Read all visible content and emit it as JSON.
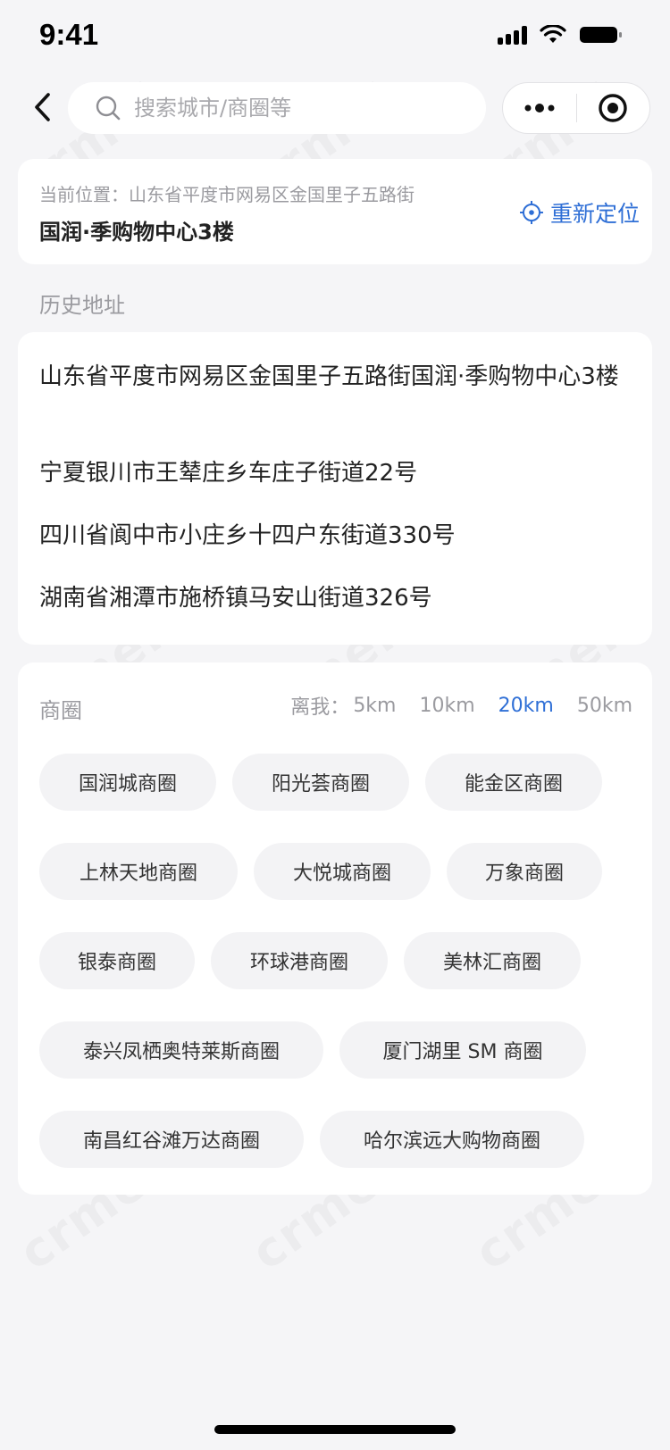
{
  "status_bar": {
    "time": "9:41"
  },
  "nav": {
    "search_placeholder": "搜索城市/商圈等",
    "back_icon": "chevron-left-icon",
    "more_icon": "more-dots-icon",
    "close_icon": "target-circle-icon"
  },
  "current_location": {
    "label": "当前位置：山东省平度市网易区金国里子五路街",
    "name": "国润·季购物中心3楼",
    "relocate_label": "重新定位",
    "relocate_icon": "locate-crosshair-icon"
  },
  "history": {
    "title": "历史地址",
    "items": [
      "山东省平度市网易区金国里子五路街国润·季购物中心3楼",
      "宁夏银川市王辇庄乡车庄子街道22号",
      "四川省阆中市小庄乡十四户东街道330号",
      "湖南省湘潭市施桥镇马安山街道326号"
    ]
  },
  "business_circles": {
    "title": "商圈",
    "distance_label": "离我：",
    "distances": [
      "5km",
      "10km",
      "20km",
      "50km"
    ],
    "selected_distance": "20km",
    "chips": [
      "国润城商圈",
      "阳光荟商圈",
      "能金区商圈",
      "上林天地商圈",
      "大悦城商圈",
      "万象商圈",
      "银泰商圈",
      "环球港商圈",
      "美林汇商圈",
      "泰兴凤栖奥特莱斯商圈",
      "厦门湖里 SM 商圈",
      "南昌红谷滩万达商圈",
      "哈尔滨远大购物商圈"
    ]
  },
  "watermark": "crmeb",
  "colors": {
    "accent": "#2f6fd6",
    "background": "#f5f5f7",
    "card": "#ffffff",
    "chip": "#f3f3f5",
    "muted_text": "#9b9ba0"
  }
}
